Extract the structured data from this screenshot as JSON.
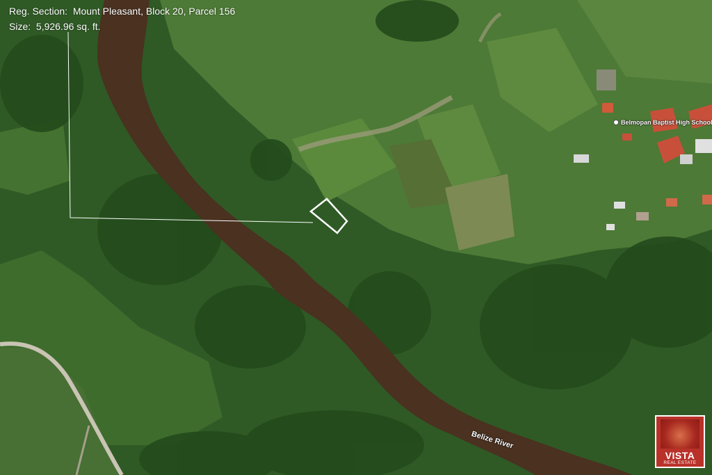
{
  "parcel": {
    "reg_section": "Reg. Section:  Mount Pleasant, Block 20, Parcel 156",
    "size": "Size:  5,926.96 sq. ft."
  },
  "map_labels": {
    "school": "Belmopan Baptist High School",
    "school_icon": "place-pin-icon",
    "river": "Belize River"
  },
  "logo": {
    "name": "VISTA",
    "tagline": "REAL ESTATE",
    "color": "#b8322a"
  },
  "colors": {
    "river": "#4a3120",
    "parcel_outline": "#ffffff",
    "forest": "#2f5a25"
  }
}
